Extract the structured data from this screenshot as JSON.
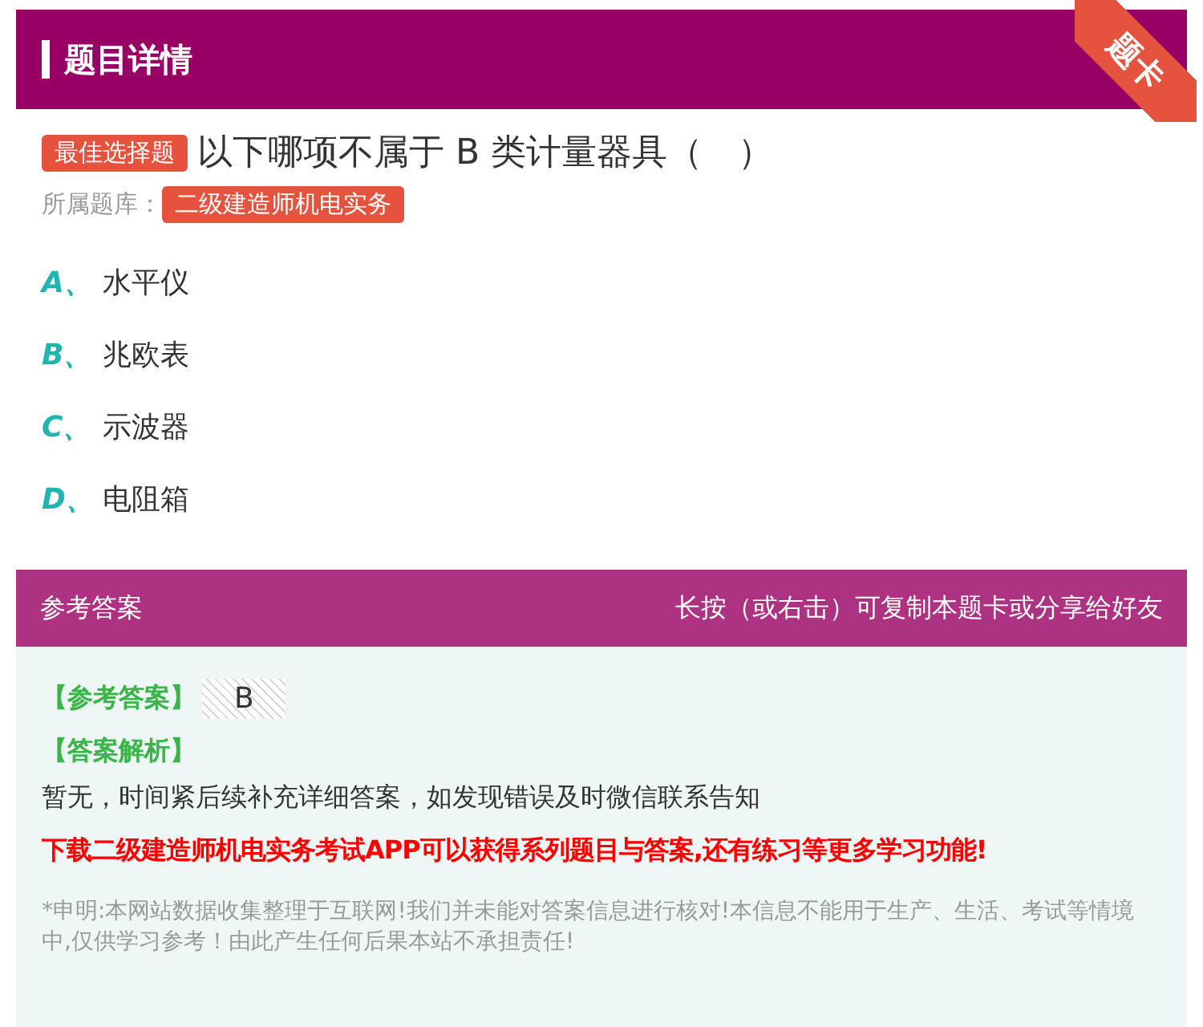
{
  "header": {
    "title": "题目详情",
    "corner_tag": "题卡"
  },
  "question": {
    "type_badge": "最佳选择题",
    "text": "以下哪项不属于 B 类计量器具（　）",
    "bank_label": "所属题库：",
    "bank": "二级建造师机电实务"
  },
  "options": [
    {
      "letter": "A、",
      "text": "水平仪"
    },
    {
      "letter": "B、",
      "text": "兆欧表"
    },
    {
      "letter": "C、",
      "text": "示波器"
    },
    {
      "letter": "D、",
      "text": "电阻箱"
    }
  ],
  "answer": {
    "title": "参考答案",
    "hint": "长按（或右击）可复制本题卡或分享给好友",
    "answer_label": "【参考答案】",
    "answer_value": "B",
    "analysis_label": "【答案解析】",
    "analysis": "暂无，时间紧后续补充详细答案，如发现错误及时微信联系告知",
    "promo": "下载二级建造师机电实务考试APP可以获得系列题目与答案,还有练习等更多学习功能!",
    "disclaimer": "*申明:本网站数据收集整理于互联网!我们并未能对答案信息进行核对!本信息不能用于生产、生活、考试等情境中,仅供学习参考！由此产生任何后果本站不承担责任!"
  }
}
